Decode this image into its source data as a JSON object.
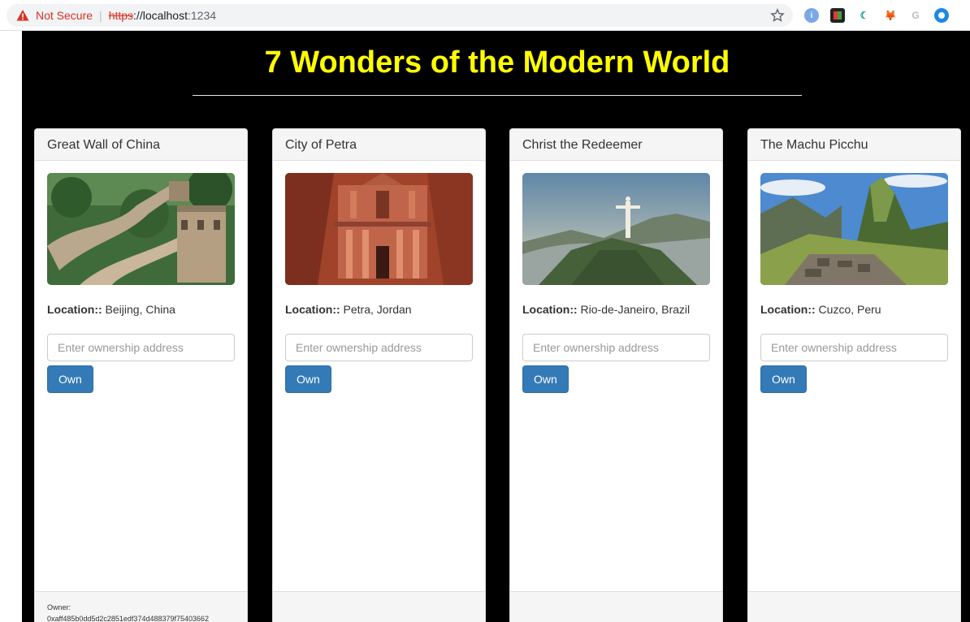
{
  "browser": {
    "not_secure": "Not Secure",
    "scheme": "https",
    "url_rest": "://localhost",
    "port": ":1234"
  },
  "page": {
    "title": "7 Wonders of the Modern World"
  },
  "cards": [
    {
      "name": "Great Wall of China",
      "location_label": "Location::",
      "location": " Beijing, China",
      "placeholder": "Enter ownership address",
      "button": "Own",
      "owner_label": "Owner:",
      "owner": "0xaff485b0dd5d2c2851edf374d488379f75403662"
    },
    {
      "name": "City of Petra",
      "location_label": "Location::",
      "location": " Petra, Jordan",
      "placeholder": "Enter ownership address",
      "button": "Own"
    },
    {
      "name": "Christ the Redeemer",
      "location_label": "Location::",
      "location": " Rio-de-Janeiro, Brazil",
      "placeholder": "Enter ownership address",
      "button": "Own"
    },
    {
      "name": "The Machu Picchu",
      "location_label": "Location::",
      "location": " Cuzco, Peru",
      "placeholder": "Enter ownership address",
      "button": "Own"
    }
  ],
  "colors": {
    "title": "#ffff00",
    "background": "#000000",
    "button": "#337ab7"
  }
}
